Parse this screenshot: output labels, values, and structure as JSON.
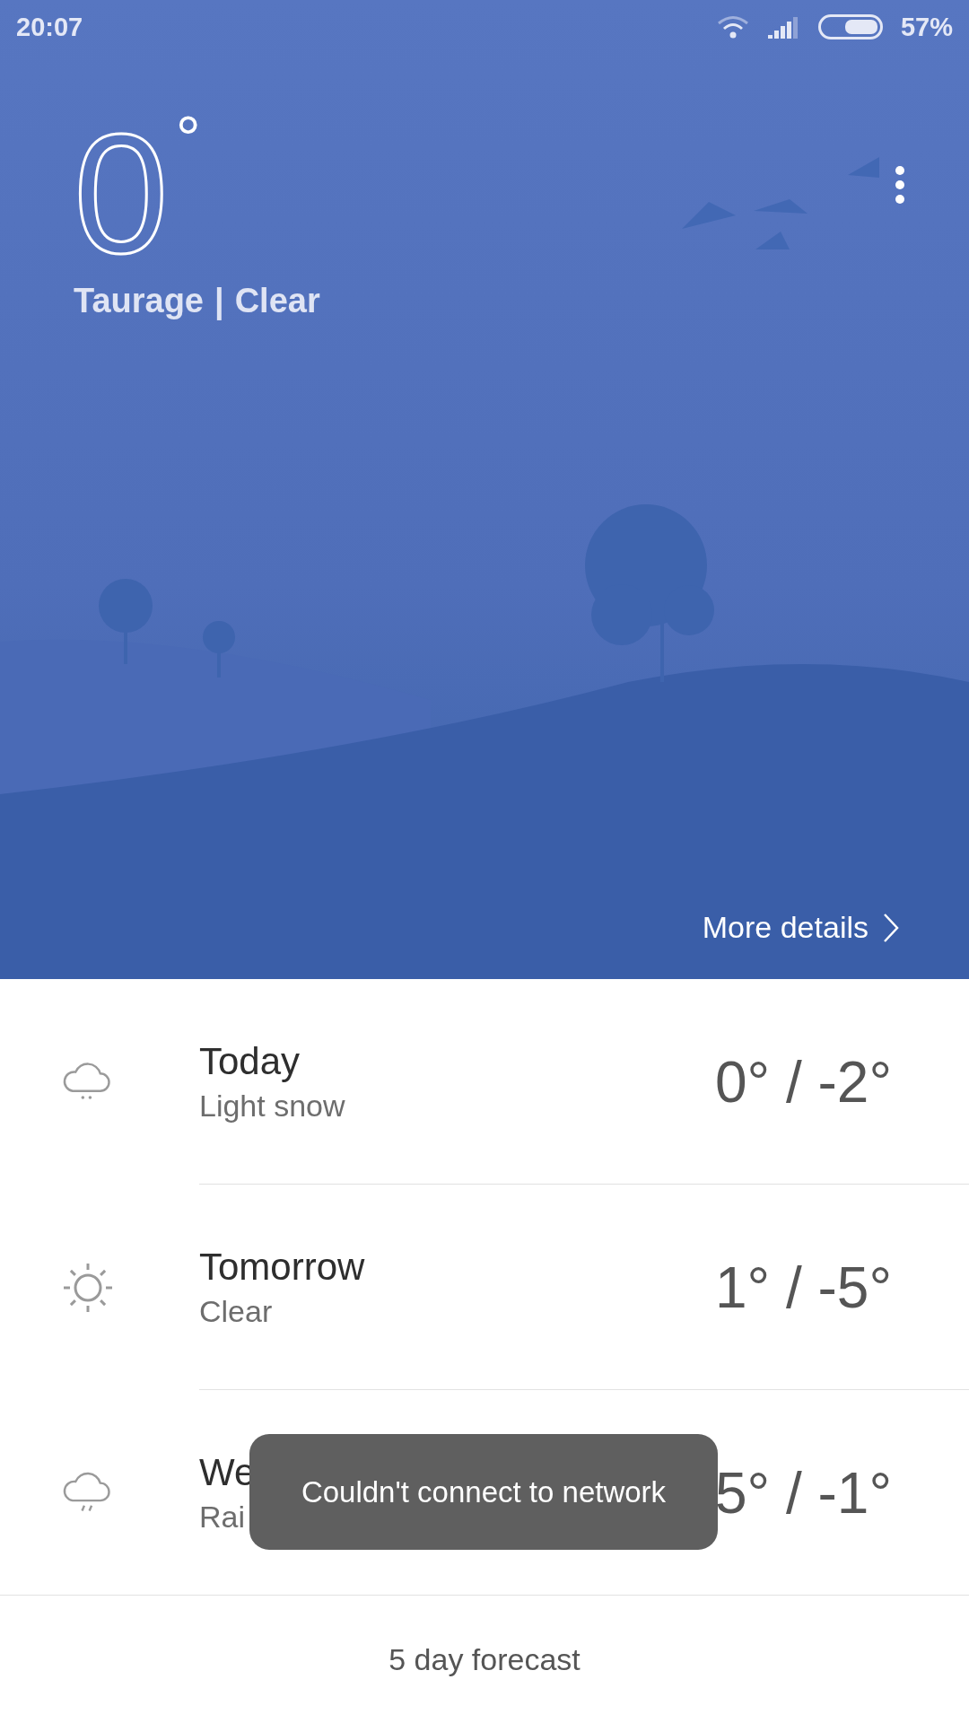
{
  "status_bar": {
    "time": "20:07",
    "battery": "57%"
  },
  "current": {
    "temperature": "0",
    "degree": "°",
    "city": "Taurage",
    "separator": "|",
    "condition": "Clear"
  },
  "more_details": {
    "label": "More details"
  },
  "forecast": [
    {
      "kind": "snow",
      "day": "Today",
      "condition": "Light snow",
      "temps": "0° / -2°"
    },
    {
      "kind": "clear",
      "day": "Tomorrow",
      "condition": "Clear",
      "temps": "1° / -5°"
    },
    {
      "kind": "rain",
      "day": "We",
      "condition": "Rai",
      "temps": "5° / -1°"
    }
  ],
  "toast": {
    "message": "Couldn't connect to network"
  },
  "footer": {
    "label": "5 day forecast"
  }
}
